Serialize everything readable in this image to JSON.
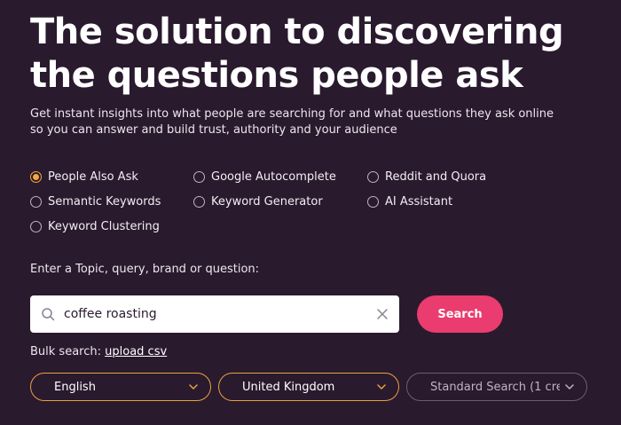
{
  "hero": {
    "title": "The solution to discovering the questions people ask",
    "subtitle": "Get instant insights into what people are searching for and what questions they ask online so you can answer and build trust, authority and your audience"
  },
  "options": [
    {
      "label": "People Also Ask",
      "checked": true
    },
    {
      "label": "Google Autocomplete",
      "checked": false
    },
    {
      "label": "Reddit and Quora",
      "checked": false
    },
    {
      "label": "Semantic Keywords",
      "checked": false
    },
    {
      "label": "Keyword Generator",
      "checked": false
    },
    {
      "label": "AI Assistant",
      "checked": false
    },
    {
      "label": "Keyword Clustering",
      "checked": false
    }
  ],
  "search": {
    "label": "Enter a Topic, query, brand or question:",
    "value": "coffee roasting",
    "button_label": "Search"
  },
  "bulk": {
    "prefix": "Bulk search:",
    "link_label": "upload csv"
  },
  "selects": {
    "language": "English",
    "country": "United Kingdom",
    "mode": "Standard Search (1 cre"
  },
  "colors": {
    "background": "#2a1a2e",
    "accent_orange": "#f4a93a",
    "search_button": "#ea3c6e"
  }
}
